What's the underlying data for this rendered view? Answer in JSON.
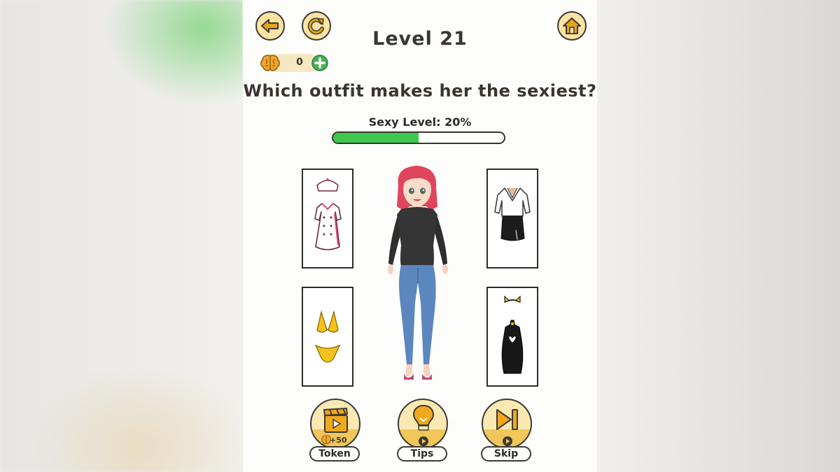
{
  "header": {
    "level_title": "Level 21",
    "coins": "0",
    "back_icon": "back-arrow-icon",
    "restart_icon": "restart-icon",
    "home_icon": "home-icon"
  },
  "question": "Which outfit makes her the sexiest?",
  "meter": {
    "label": "Sexy Level: 20%",
    "value_percent": 50,
    "fill_color": "#3cc94e"
  },
  "outfits": [
    {
      "name": "nurse-uniform"
    },
    {
      "name": "office-blouse-and-pencil-skirt"
    },
    {
      "name": "yellow-bikini"
    },
    {
      "name": "black-cat-dress"
    }
  ],
  "actions": [
    {
      "label": "Token",
      "badge": "+50",
      "icon": "video-clapper-icon"
    },
    {
      "label": "Tips",
      "icon": "lightbulb-icon"
    },
    {
      "label": "Skip",
      "icon": "skip-icon"
    }
  ],
  "colors": {
    "button_fill": "#fbe3a4",
    "accent": "#f1c75a",
    "text": "#3b3530"
  }
}
